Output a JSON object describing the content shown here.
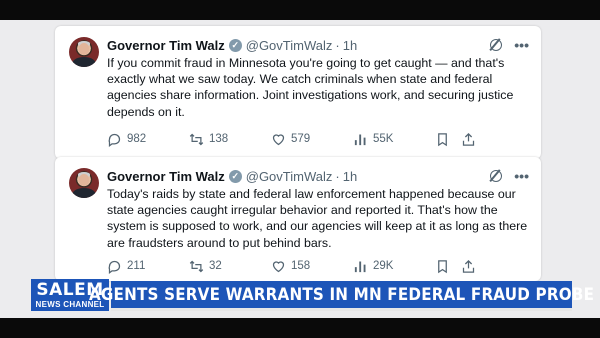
{
  "tweets": [
    {
      "name": "Governor Tim Walz",
      "handle": "@GovTimWalz",
      "separator": "·",
      "time": "1h",
      "text": "If you commit fraud in Minnesota you're going to get caught — and that's exactly what we saw today. We catch criminals when state and federal agencies share information. Joint investigations work, and securing justice depends on it.",
      "replies": "982",
      "reposts": "138",
      "likes": "579",
      "views": "55K"
    },
    {
      "name": "Governor Tim Walz",
      "handle": "@GovTimWalz",
      "separator": "·",
      "time": "1h",
      "text": "Today's raids by state and federal law enforcement happened because our state agencies caught irregular behavior and reported it. That's how the system is supposed to work, and our agencies will keep at it as long as there are fraudsters around to put behind bars.",
      "replies": "211",
      "reposts": "32",
      "likes": "158",
      "views": "29K"
    }
  ],
  "icons": {
    "verified": "verified-badge-icon",
    "grok": "grok-icon",
    "more": "more-icon",
    "more_glyph": "•••",
    "reply": "reply-icon",
    "repost": "repost-icon",
    "like": "heart-icon",
    "views": "views-icon",
    "bookmark": "bookmark-icon",
    "share": "share-icon"
  },
  "lower_third": {
    "logo_main": "SALEM",
    "logo_sub": "NEWS CHANNEL",
    "headline": "AGENTS SERVE WARRANTS IN MN FEDERAL FRAUD PROBE"
  },
  "colors": {
    "brand_blue": "#1d55b8",
    "text_primary": "#0f1419",
    "text_secondary": "#536471",
    "background": "#ececee"
  }
}
